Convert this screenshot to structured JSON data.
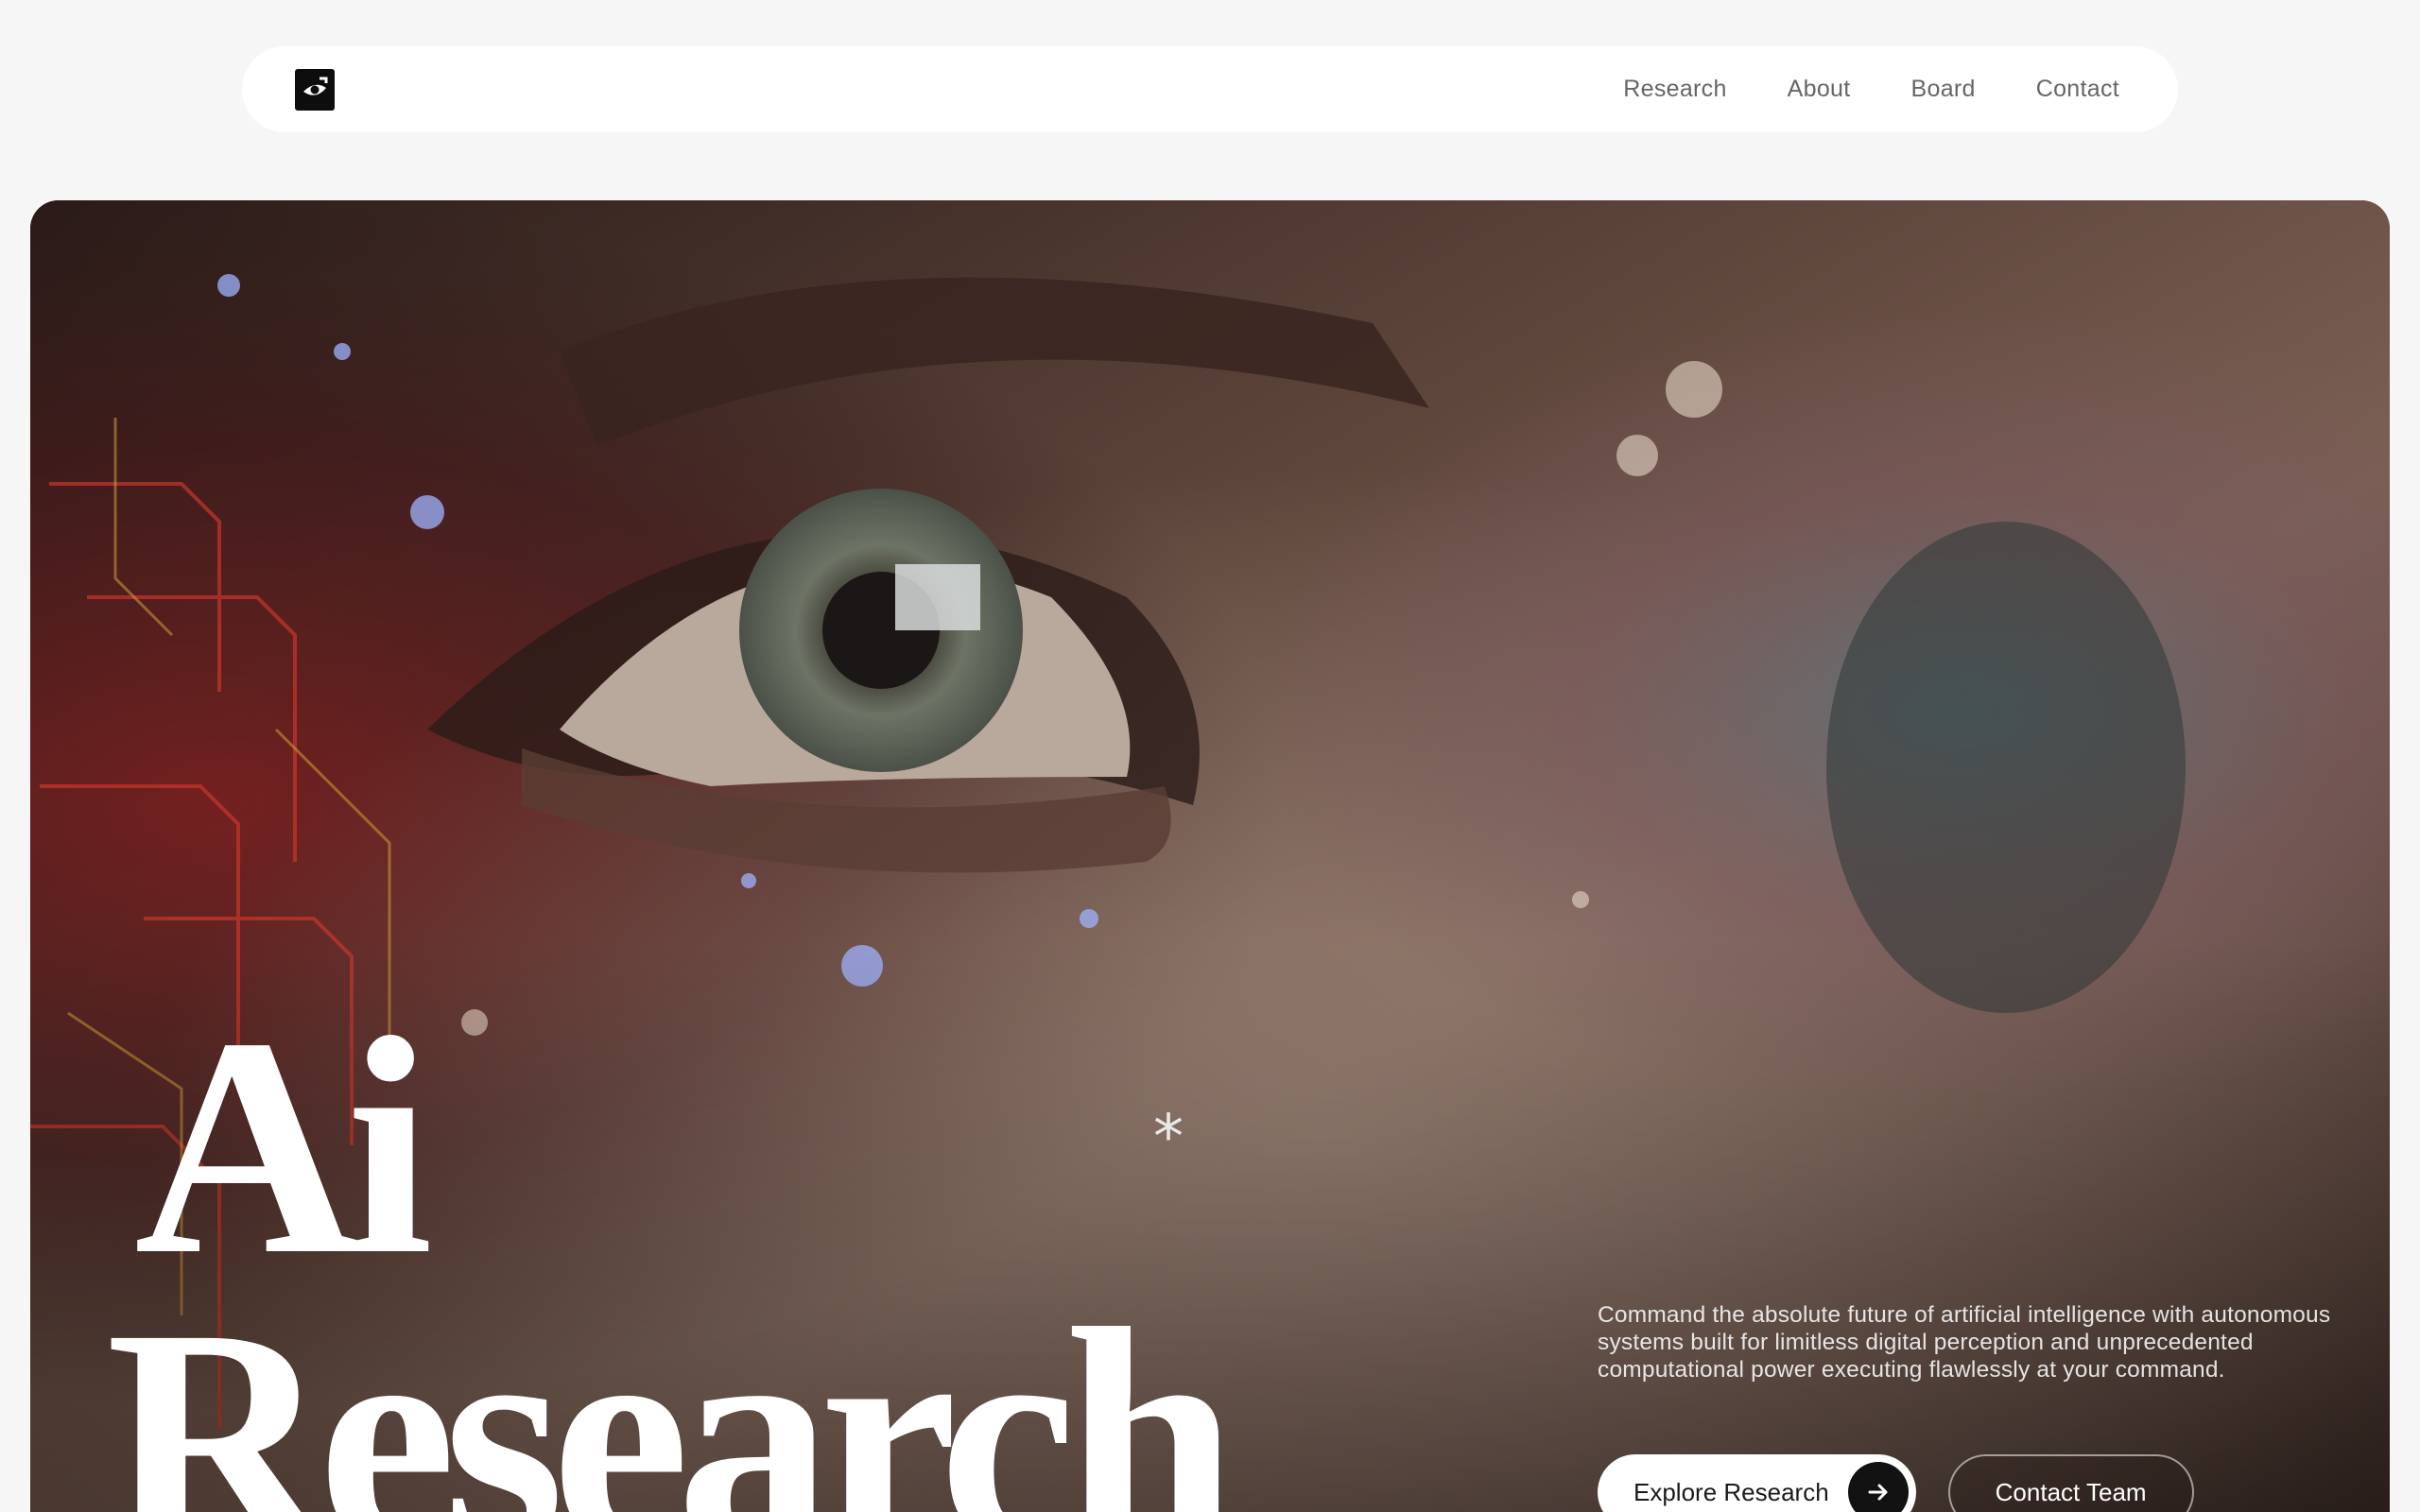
{
  "nav": {
    "logo_icon": "eye-logo-icon",
    "links": [
      "Research",
      "About",
      "Board",
      "Contact"
    ]
  },
  "hero": {
    "headline_line1": "Ai",
    "headline_line2": "Research",
    "asterisk": "*",
    "blurb": "Command the absolute future of artificial intelligence with autonomous systems built for limitless digital perception and unprecedented computational power executing flawlessly at your command.",
    "primary_cta": "Explore Research",
    "primary_cta_icon": "arrow-right-icon",
    "secondary_cta": "Contact Team"
  },
  "colors": {
    "page_bg": "#f6f6f6",
    "nav_bg": "#ffffff",
    "text_muted": "#666666",
    "accent_dark": "#121212"
  }
}
